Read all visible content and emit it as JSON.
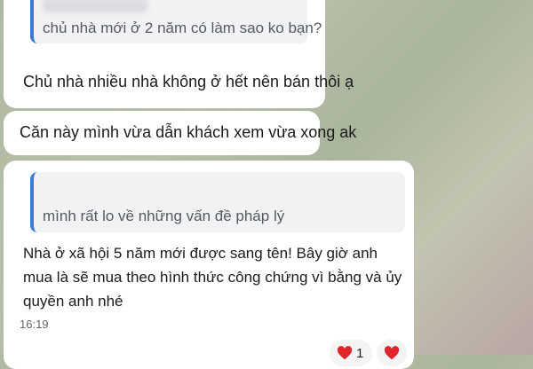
{
  "messages": [
    {
      "quote": "chủ nhà mới ở 2 năm có làm sao ko bạn?",
      "text": "Chủ nhà nhiều nhà không ở hết nên bán thôi ạ"
    },
    {
      "text": "Căn này mình vừa dẫn khách xem vừa xong ak"
    },
    {
      "quote": "mình rất lo về những vấn đề pháp lý",
      "text": "Nhà ở xã hội 5 năm mới được sang tên! Bây giờ anh mua là sẽ mua theo hình thức công chứng vì bằng và ủy quyền anh nhé",
      "time": "16:19",
      "reactions": [
        {
          "icon": "heart-icon",
          "count": "1"
        },
        {
          "icon": "heart-icon",
          "count": ""
        }
      ]
    }
  ],
  "colors": {
    "quote_bar": "#3a7bd5",
    "heart": "#e0262a",
    "bubble": "#ffffff"
  }
}
